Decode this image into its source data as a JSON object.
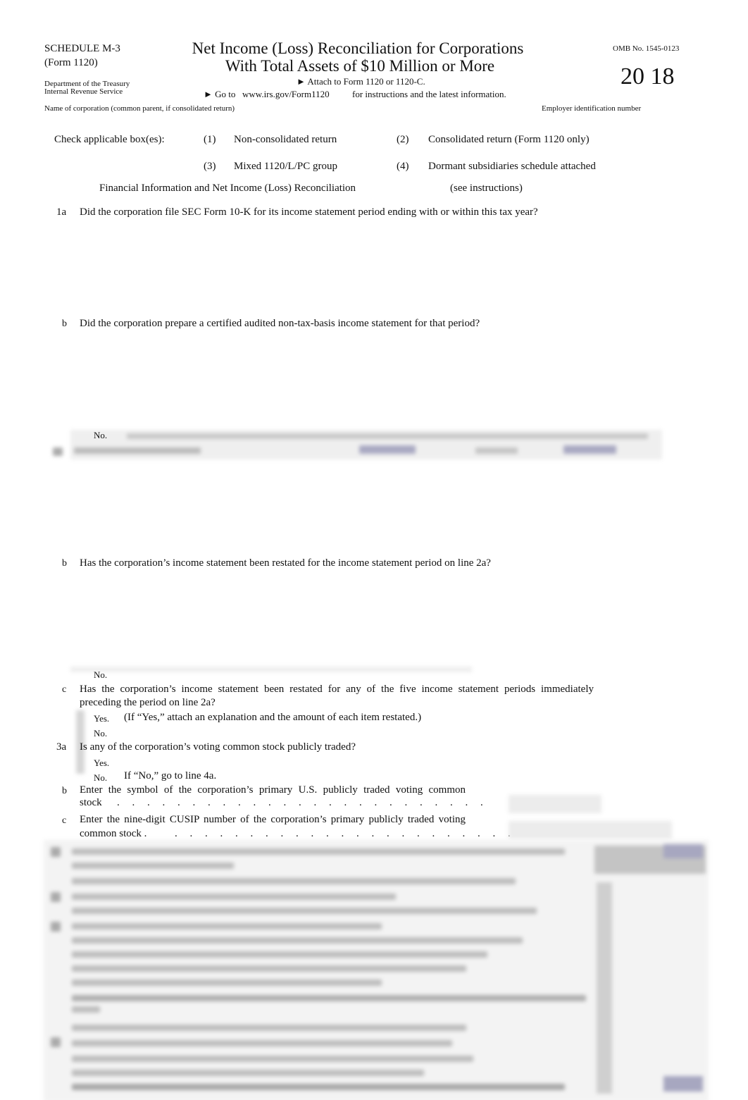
{
  "header": {
    "schedule": "SCHEDULE M-3",
    "form": "(Form 1120)",
    "department": "Department of the Treasury",
    "service": "Internal Revenue Service",
    "title_line1": "Net Income (Loss) Reconciliation for Corporations",
    "title_line2": "With Total Assets of $10 Million or More",
    "attach": "► Attach to Form 1120 or 1120-C.",
    "goto_prefix": "► Go to",
    "goto_url": "www.irs.gov/Form1120",
    "goto_suffix": "for instructions and the latest information.",
    "omb": "OMB No. 1545-0123",
    "year": "20 18",
    "name_label": "Name of corporation (common parent, if consolidated return)",
    "ein_label": "Employer identification number"
  },
  "checkboxes": {
    "label": "Check applicable box(es):",
    "items": [
      {
        "num": "(1)",
        "label": "Non-consolidated return"
      },
      {
        "num": "(2)",
        "label": "Consolidated return (Form 1120 only)"
      },
      {
        "num": "(3)",
        "label": "Mixed 1120/L/PC group"
      },
      {
        "num": "(4)",
        "label": "Dormant subsidiaries schedule attached"
      }
    ]
  },
  "section": {
    "title": "Financial Information and Net Income (Loss) Reconciliation",
    "note": "(see instructions)"
  },
  "lines": {
    "l1a": {
      "num": "1a",
      "text": "Did the corporation file SEC Form 10-K for its income statement period ending with or within this tax year?"
    },
    "l1b": {
      "num": "b",
      "text": "Did the corporation prepare a certified audited non-tax-basis income statement for that period?",
      "no": "No."
    },
    "l2b": {
      "num": "b",
      "text": "Has the corporation’s income statement been restated for the income statement period on line 2a?",
      "no": "No."
    },
    "l2c": {
      "num": "c",
      "text1": "Has the corporation’s income statement been restated for any of the five income statement periods immediately",
      "text2": "preceding the period on line 2a?",
      "yes": "Yes.",
      "yes_note": "(If “Yes,” attach an explanation and the amount of each item restated.)",
      "no": "No."
    },
    "l3a": {
      "num": "3a",
      "text": "Is any of the corporation’s voting common stock publicly traded?",
      "yes": "Yes.",
      "no": "No.",
      "no_note": "If “No,” go to line 4a."
    },
    "l3b": {
      "num": "b",
      "text1": "Enter the symbol of the corporation’s primary U.S. publicly traded voting common",
      "text2": "stock",
      "dots": ". . . . . . . . . . . . . . . . . . . . . . . . ."
    },
    "l3c": {
      "num": "c",
      "text1": "Enter the nine-digit CUSIP number of the corporation’s primary publicly traded voting",
      "text2": "common  stock .",
      "dots": ". . . . . . . . . . . . . . . . . . . . . . ."
    }
  }
}
